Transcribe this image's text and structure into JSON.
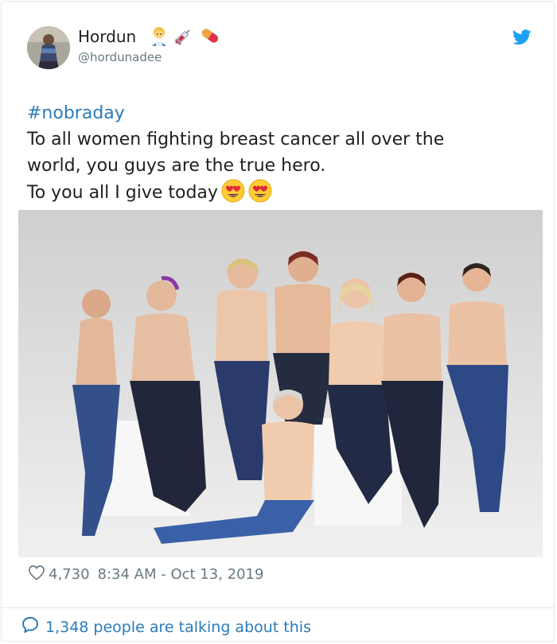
{
  "author": {
    "display_name": "Hordun",
    "handle": "@hordunadee",
    "name_emojis": [
      "woman-office-worker-emoji",
      "syringe-emoji",
      "pill-emoji"
    ]
  },
  "tweet": {
    "hashtag": "#nobraday",
    "lines": [
      "To all women fighting breast cancer all over the",
      "world, you guys are the true hero.",
      "To you all I give today"
    ],
    "trailing_emojis": [
      "heart-eyes-emoji",
      "heart-eyes-emoji"
    ]
  },
  "footer": {
    "likes": "4,730",
    "timestamp": "8:34 AM - Oct 13, 2019",
    "talking": "1,348 people are talking about this"
  },
  "colors": {
    "link": "#2b7bb9",
    "muted": "#697882",
    "text": "#1c2022",
    "border": "#e1e8ed",
    "twitter_blue": "#1da1f2"
  },
  "icons": {
    "brand": "twitter-bird-icon",
    "like": "heart-outline-icon",
    "reply": "speech-bubble-icon"
  }
}
